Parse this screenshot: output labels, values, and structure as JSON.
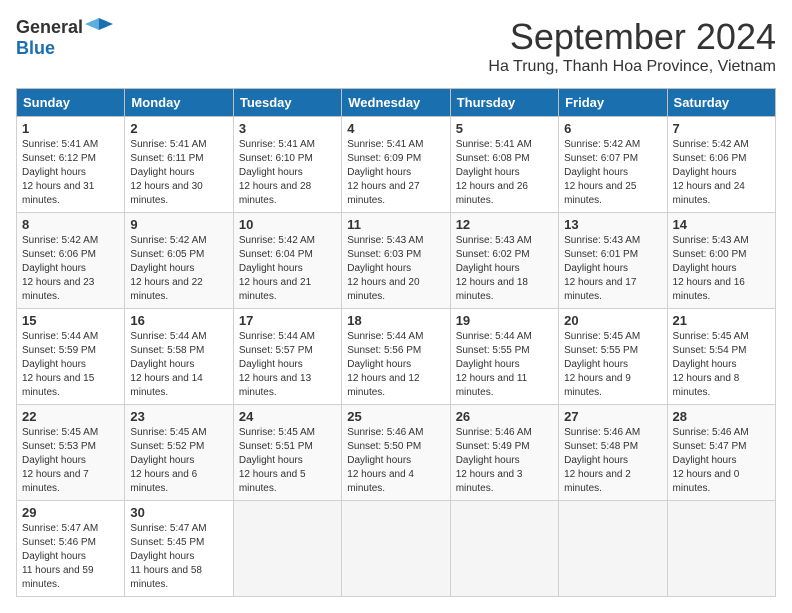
{
  "logo": {
    "general": "General",
    "blue": "Blue"
  },
  "title": "September 2024",
  "location": "Ha Trung, Thanh Hoa Province, Vietnam",
  "days": [
    "Sunday",
    "Monday",
    "Tuesday",
    "Wednesday",
    "Thursday",
    "Friday",
    "Saturday"
  ],
  "weeks": [
    [
      {
        "day": "1",
        "sunrise": "5:41 AM",
        "sunset": "6:12 PM",
        "daylight": "12 hours and 31 minutes."
      },
      {
        "day": "2",
        "sunrise": "5:41 AM",
        "sunset": "6:11 PM",
        "daylight": "12 hours and 30 minutes."
      },
      {
        "day": "3",
        "sunrise": "5:41 AM",
        "sunset": "6:10 PM",
        "daylight": "12 hours and 28 minutes."
      },
      {
        "day": "4",
        "sunrise": "5:41 AM",
        "sunset": "6:09 PM",
        "daylight": "12 hours and 27 minutes."
      },
      {
        "day": "5",
        "sunrise": "5:41 AM",
        "sunset": "6:08 PM",
        "daylight": "12 hours and 26 minutes."
      },
      {
        "day": "6",
        "sunrise": "5:42 AM",
        "sunset": "6:07 PM",
        "daylight": "12 hours and 25 minutes."
      },
      {
        "day": "7",
        "sunrise": "5:42 AM",
        "sunset": "6:06 PM",
        "daylight": "12 hours and 24 minutes."
      }
    ],
    [
      {
        "day": "8",
        "sunrise": "5:42 AM",
        "sunset": "6:06 PM",
        "daylight": "12 hours and 23 minutes."
      },
      {
        "day": "9",
        "sunrise": "5:42 AM",
        "sunset": "6:05 PM",
        "daylight": "12 hours and 22 minutes."
      },
      {
        "day": "10",
        "sunrise": "5:42 AM",
        "sunset": "6:04 PM",
        "daylight": "12 hours and 21 minutes."
      },
      {
        "day": "11",
        "sunrise": "5:43 AM",
        "sunset": "6:03 PM",
        "daylight": "12 hours and 20 minutes."
      },
      {
        "day": "12",
        "sunrise": "5:43 AM",
        "sunset": "6:02 PM",
        "daylight": "12 hours and 18 minutes."
      },
      {
        "day": "13",
        "sunrise": "5:43 AM",
        "sunset": "6:01 PM",
        "daylight": "12 hours and 17 minutes."
      },
      {
        "day": "14",
        "sunrise": "5:43 AM",
        "sunset": "6:00 PM",
        "daylight": "12 hours and 16 minutes."
      }
    ],
    [
      {
        "day": "15",
        "sunrise": "5:44 AM",
        "sunset": "5:59 PM",
        "daylight": "12 hours and 15 minutes."
      },
      {
        "day": "16",
        "sunrise": "5:44 AM",
        "sunset": "5:58 PM",
        "daylight": "12 hours and 14 minutes."
      },
      {
        "day": "17",
        "sunrise": "5:44 AM",
        "sunset": "5:57 PM",
        "daylight": "12 hours and 13 minutes."
      },
      {
        "day": "18",
        "sunrise": "5:44 AM",
        "sunset": "5:56 PM",
        "daylight": "12 hours and 12 minutes."
      },
      {
        "day": "19",
        "sunrise": "5:44 AM",
        "sunset": "5:55 PM",
        "daylight": "12 hours and 11 minutes."
      },
      {
        "day": "20",
        "sunrise": "5:45 AM",
        "sunset": "5:55 PM",
        "daylight": "12 hours and 9 minutes."
      },
      {
        "day": "21",
        "sunrise": "5:45 AM",
        "sunset": "5:54 PM",
        "daylight": "12 hours and 8 minutes."
      }
    ],
    [
      {
        "day": "22",
        "sunrise": "5:45 AM",
        "sunset": "5:53 PM",
        "daylight": "12 hours and 7 minutes."
      },
      {
        "day": "23",
        "sunrise": "5:45 AM",
        "sunset": "5:52 PM",
        "daylight": "12 hours and 6 minutes."
      },
      {
        "day": "24",
        "sunrise": "5:45 AM",
        "sunset": "5:51 PM",
        "daylight": "12 hours and 5 minutes."
      },
      {
        "day": "25",
        "sunrise": "5:46 AM",
        "sunset": "5:50 PM",
        "daylight": "12 hours and 4 minutes."
      },
      {
        "day": "26",
        "sunrise": "5:46 AM",
        "sunset": "5:49 PM",
        "daylight": "12 hours and 3 minutes."
      },
      {
        "day": "27",
        "sunrise": "5:46 AM",
        "sunset": "5:48 PM",
        "daylight": "12 hours and 2 minutes."
      },
      {
        "day": "28",
        "sunrise": "5:46 AM",
        "sunset": "5:47 PM",
        "daylight": "12 hours and 0 minutes."
      }
    ],
    [
      {
        "day": "29",
        "sunrise": "5:47 AM",
        "sunset": "5:46 PM",
        "daylight": "11 hours and 59 minutes."
      },
      {
        "day": "30",
        "sunrise": "5:47 AM",
        "sunset": "5:45 PM",
        "daylight": "11 hours and 58 minutes."
      },
      null,
      null,
      null,
      null,
      null
    ]
  ],
  "labels": {
    "sunrise": "Sunrise: ",
    "sunset": "Sunset: ",
    "daylight": "Daylight hours"
  }
}
